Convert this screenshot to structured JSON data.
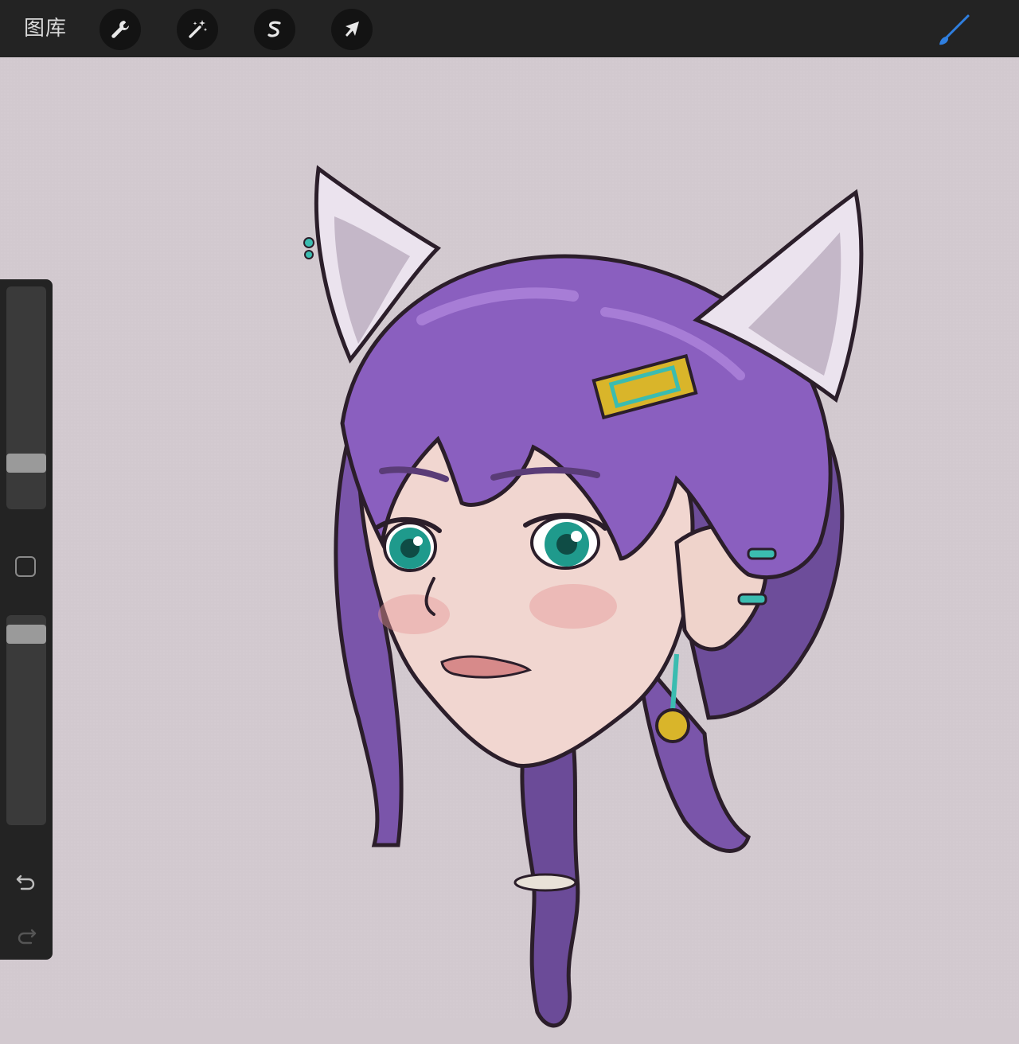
{
  "toolbar": {
    "gallery_label": "图库",
    "tools": [
      {
        "name": "actions",
        "icon": "wrench-icon"
      },
      {
        "name": "adjustments",
        "icon": "magic-wand-icon"
      },
      {
        "name": "selection",
        "icon": "selection-s-icon"
      },
      {
        "name": "transform",
        "icon": "arrow-cursor-icon"
      }
    ],
    "active_tool_icon": "brush-icon",
    "accent_color": "#2f7fe0"
  },
  "sidebar": {
    "brush_size_level": 0.23,
    "opacity_level": 0.97,
    "icons": [
      "modify-square-icon",
      "undo-icon",
      "redo-icon"
    ]
  },
  "canvas": {
    "background_color": "#d2c9cf",
    "artwork": "purple-haired-cat-eared-girl-illustration"
  }
}
